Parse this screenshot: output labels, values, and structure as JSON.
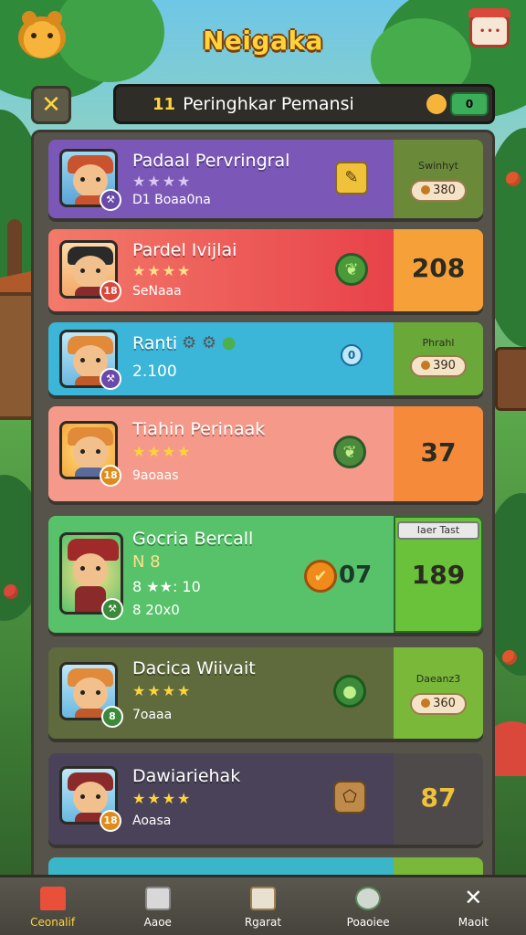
{
  "header": {
    "title": "Neigaka",
    "search_prefix": "11",
    "search_label": "Peringhkar Pemansi",
    "toggle_label": "0"
  },
  "close_label": "✕",
  "players": [
    {
      "name": "Padaal Pervringral",
      "stars": "★★★★",
      "sub": "D1 Boaa0na",
      "score_label": "Swinhyt",
      "score_value": "380",
      "badge": "⚒"
    },
    {
      "name": "Pardel Ivijlai",
      "stars": "★★★★",
      "sub": "SeNaaa",
      "score_big": "208",
      "badge": "18"
    },
    {
      "name": "Ranti",
      "stars": "",
      "sub": "2.100",
      "score_label": "Phrahl",
      "score_value": "390",
      "mid": "0",
      "badge": "⚒"
    },
    {
      "name": "Tiahin Perinaak",
      "stars": "★★★★",
      "sub": "9aoaas",
      "score_big": "37",
      "badge": "18"
    },
    {
      "name": "Gocria Bercall",
      "rank": "N 8",
      "stars_row": "8 ★★: 10",
      "sub": "8 20x0",
      "mid_value": "07",
      "score_label": "Iaer Tast",
      "score_big": "189",
      "badge": "⚒"
    },
    {
      "name": "Dacica Wiivait",
      "stars": "★★★★",
      "sub": "7oaaa",
      "score_label": "Daeanz3",
      "score_value": "360",
      "badge": "8"
    },
    {
      "name": "Dawiariehak",
      "stars": "★★★★",
      "sub": "Aoasa",
      "score_big": "87",
      "badge": "18"
    }
  ],
  "nav": [
    {
      "label": "Ceonalif",
      "icon": "home-icon"
    },
    {
      "label": "Aaoe",
      "icon": "camera-icon"
    },
    {
      "label": "Rgarat",
      "icon": "card-icon"
    },
    {
      "label": "Poaoiee",
      "icon": "clock-icon"
    },
    {
      "label": "Maoit",
      "icon": "close-icon"
    }
  ],
  "colors": {
    "row1": "#7b58b8",
    "row2": "#f0665c",
    "row3": "#3bb5d8",
    "row4": "#f59a8a",
    "row5": "#57c26a",
    "row6": "#5f6b3d",
    "row7": "#4a4258",
    "accent_gold": "#ffd43b"
  }
}
